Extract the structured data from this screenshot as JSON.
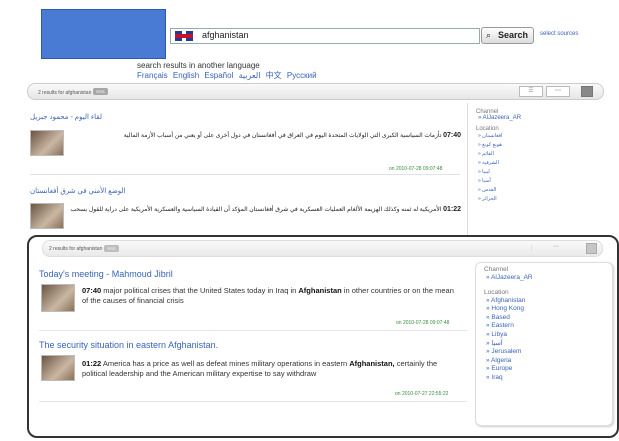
{
  "search": {
    "query": "afghanistan",
    "button_label": "Search",
    "select_sources": "select sources"
  },
  "languages": {
    "prompt": "search results in another language",
    "items": [
      "Français",
      "English",
      "Español",
      "العربية",
      "中文",
      "Русский"
    ]
  },
  "top": {
    "results_count": "2 results for afghanistan",
    "badge": "RSS",
    "results": [
      {
        "title": "لقاء اليوم - محمود جبريل",
        "time": "07:40",
        "text": "تأزمات السياسية الكبرى التي الولايات المتحدة اليوم في العراق في أفغانستان في دول أخرى على أو يعني من أسباب الأزمة المالية",
        "date": "on 2010-07-28 09:07:48"
      },
      {
        "title": "الوضع الأمني في شرق أفغانستان",
        "time": "01:22",
        "text": "الأمريكية له ثمنه وكذلك الهزيمة الألغام العمليات العسكرية في شرق أفغانستان المؤكد أن القيادة السياسية والعسكرية الأمريكية على دراية للقول بسحب",
        "date": ""
      }
    ],
    "facets": {
      "channel_heading": "Channel",
      "channel": "» AlJazeera_AR",
      "location_heading": "Location",
      "locations": [
        "» افغانستان",
        "» هونغ كونغ",
        "» القائم",
        "» الشرقية",
        "» ليبيا",
        "» آسيا",
        "» القدس",
        "» الجزائر"
      ]
    }
  },
  "overlay": {
    "results_count": "2 results for afghanistan",
    "badge": "RSS",
    "results": [
      {
        "title": "Today's meeting - Mahmoud Jibril",
        "time": "07:40",
        "text_before": " major political crises that the United States today in Iraq in ",
        "keyword": "Afghanistan",
        "text_after": " in other countries or on the mean of the causes of financial crisis",
        "date": "on 2010-07-28 09:07:48"
      },
      {
        "title": "The security situation in eastern Afghanistan.",
        "time": "01:22",
        "text_before": " America has a price  as well as defeat mines military operations in eastern ",
        "keyword": "Afghanistan,",
        "text_after": " certainly the political leadership and the American military expertise to say withdraw",
        "date": "on 2010-07-27 22:55:22"
      }
    ],
    "facets": {
      "channel_heading": "Channel",
      "channel": "» AlJazeera_AR",
      "location_heading": "Location",
      "locations": [
        "» Afghanistan",
        "» Hong Kong",
        "» Based",
        "» Eastern",
        "» Libya",
        "» آسيا",
        "» Jerusalem",
        "» Algeria",
        "» Europe",
        "» Iraq"
      ]
    }
  }
}
